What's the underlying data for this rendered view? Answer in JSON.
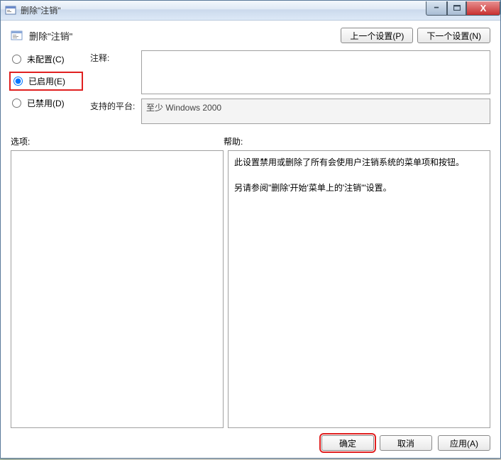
{
  "window": {
    "title": "删除\"注销\""
  },
  "header": {
    "policy_name": "删除\"注销\"",
    "prev_button": "上一个设置(P)",
    "next_button": "下一个设置(N)"
  },
  "radios": {
    "not_configured": "未配置(C)",
    "enabled": "已启用(E)",
    "disabled": "已禁用(D)",
    "selected": "enabled"
  },
  "fields": {
    "comment_label": "注释:",
    "comment_value": "",
    "platform_label": "支持的平台:",
    "platform_value": "至少 Windows 2000"
  },
  "sections": {
    "options_label": "选项:",
    "help_label": "帮助:"
  },
  "help": {
    "p1": "此设置禁用或删除了所有会使用户注销系统的菜单项和按钮。",
    "p2": "另请参阅\"删除'开始'菜单上的'注销'\"设置。"
  },
  "footer": {
    "ok": "确定",
    "cancel": "取消",
    "apply": "应用(A)"
  }
}
